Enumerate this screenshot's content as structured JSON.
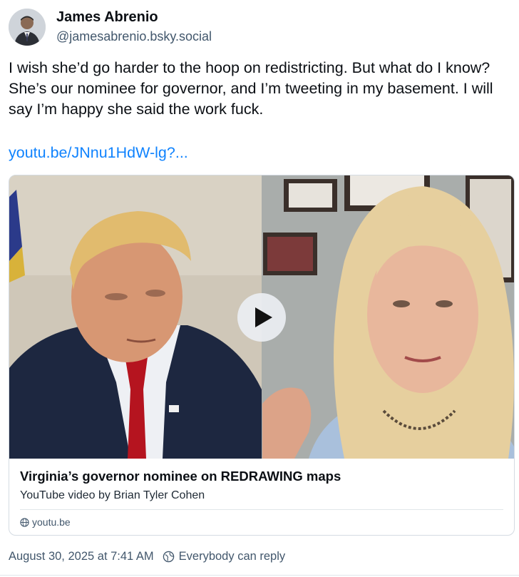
{
  "author": {
    "name": "James Abrenio",
    "handle": "@jamesabrenio.bsky.social",
    "avatar_icon": "person-avatar-icon"
  },
  "post": {
    "text": "I wish she’d go harder to the hoop on redistricting. But what do I know? She’s our nominee for governor, and I’m tweeting in my basement. I will say I’m happy she said the work fuck.",
    "link_text": "youtu.be/JNnu1HdW-lg?..."
  },
  "embed": {
    "title": "Virginia’s governor nominee on REDRAWING maps",
    "description": "YouTube video by Brian Tyler Cohen",
    "domain": "youtu.be",
    "play_icon": "play-icon",
    "domain_icon": "globe-icon"
  },
  "meta": {
    "timestamp": "August 30, 2025 at 7:41 AM",
    "reply_setting": "Everybody can reply",
    "reply_icon": "globe-reply-icon"
  },
  "colors": {
    "link": "#1083fe",
    "muted": "#42576c",
    "border": "#d4dbe2"
  }
}
